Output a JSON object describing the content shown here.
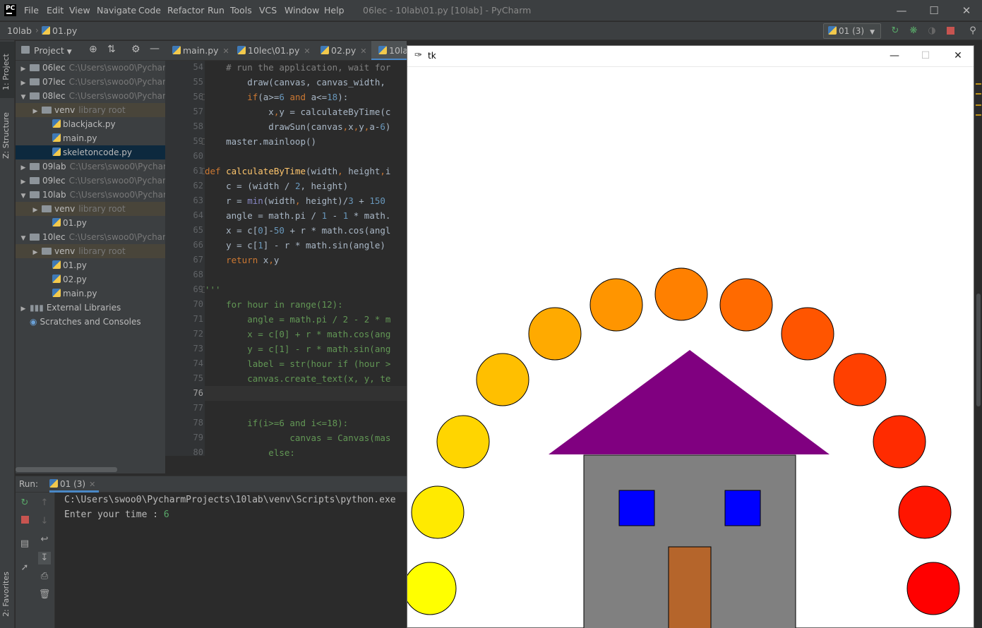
{
  "colors": {
    "accent": "#4a88c7",
    "ide_bg": "#2b2b2b",
    "panel_bg": "#3c3f41",
    "selection": "#0d293e",
    "tk_roof": "#800080",
    "tk_wall": "#808080",
    "tk_window": "#0000ff",
    "tk_door": "#b5652b"
  },
  "titlebar": {
    "menu": [
      "File",
      "Edit",
      "View",
      "Navigate",
      "Code",
      "Refactor",
      "Run",
      "Tools",
      "VCS",
      "Window",
      "Help"
    ],
    "window_title": "06lec - 10lab\\01.py [10lab] - PyCharm",
    "logo": "PC"
  },
  "navbar": {
    "crumb_project": "10lab",
    "crumb_file": "01.py",
    "run_config": "01 (3)"
  },
  "left_strip": {
    "project_tab": "1: Project",
    "structure_tab": "Z: Structure",
    "favorites_tab": "2: Favorites"
  },
  "project_panel": {
    "header": "Project",
    "tree": [
      {
        "name": "06lec",
        "path": "C:\\Users\\swoo0\\Pycharm",
        "arrow": "▶",
        "kind": "folder",
        "indent": 0
      },
      {
        "name": "07lec",
        "path": "C:\\Users\\swoo0\\Pycharm",
        "arrow": "▶",
        "kind": "folder",
        "indent": 0
      },
      {
        "name": "08lec",
        "path": "C:\\Users\\swoo0\\Pycharm",
        "arrow": "▼",
        "kind": "folder",
        "indent": 0
      },
      {
        "name": "venv",
        "hint": "library root",
        "arrow": "▶",
        "kind": "lib",
        "indent": 1
      },
      {
        "name": "blackjack.py",
        "kind": "py",
        "indent": 2
      },
      {
        "name": "main.py",
        "kind": "py",
        "indent": 2
      },
      {
        "name": "skeletoncode.py",
        "kind": "py",
        "indent": 2,
        "selected": true
      },
      {
        "name": "09lab",
        "path": "C:\\Users\\swoo0\\Pychar",
        "arrow": "▶",
        "kind": "folder",
        "indent": 0
      },
      {
        "name": "09lec",
        "path": "C:\\Users\\swoo0\\Pycharm",
        "arrow": "▶",
        "kind": "folder",
        "indent": 0
      },
      {
        "name": "10lab",
        "path": "C:\\Users\\swoo0\\Pychar",
        "arrow": "▼",
        "kind": "folder",
        "indent": 0
      },
      {
        "name": "venv",
        "hint": "library root",
        "arrow": "▶",
        "kind": "lib",
        "indent": 1
      },
      {
        "name": "01.py",
        "kind": "py",
        "indent": 2
      },
      {
        "name": "10lec",
        "path": "C:\\Users\\swoo0\\Pycharm",
        "arrow": "▼",
        "kind": "folder",
        "indent": 0
      },
      {
        "name": "venv",
        "hint": "library root",
        "arrow": "▶",
        "kind": "lib",
        "indent": 1
      },
      {
        "name": "01.py",
        "kind": "py",
        "indent": 2
      },
      {
        "name": "02.py",
        "kind": "py",
        "indent": 2
      },
      {
        "name": "main.py",
        "kind": "py",
        "indent": 2
      },
      {
        "name": "External Libraries",
        "arrow": "▶",
        "kind": "extlib",
        "indent": 0
      },
      {
        "name": "Scratches and Consoles",
        "kind": "scratch",
        "indent": 0
      }
    ]
  },
  "editor": {
    "tabs": [
      {
        "label": "main.py"
      },
      {
        "label": "10lec\\01.py"
      },
      {
        "label": "02.py"
      },
      {
        "label": "10la"
      }
    ],
    "line_numbers": [
      "54",
      "55",
      "56",
      "57",
      "58",
      "59",
      "60",
      "61",
      "62",
      "63",
      "64",
      "65",
      "66",
      "67",
      "68",
      "69",
      "70",
      "71",
      "72",
      "73",
      "74",
      "75",
      "76",
      "77",
      "78",
      "79",
      "80"
    ],
    "current_line": "76",
    "lines": [
      [
        {
          "t": "    # run the application, wait for",
          "c": "#808080"
        }
      ],
      [
        {
          "t": "        draw(canvas, canvas_width,",
          "c": "#a9b7c6"
        }
      ],
      [
        {
          "t": "        ",
          "c": "#a9b7c6"
        },
        {
          "t": "if",
          "c": "#cc7832"
        },
        {
          "t": "(a>=",
          "c": "#a9b7c6"
        },
        {
          "t": "6",
          "c": "#6897bb"
        },
        {
          "t": " and ",
          "c": "#cc7832"
        },
        {
          "t": "a<=",
          "c": "#a9b7c6"
        },
        {
          "t": "18",
          "c": "#6897bb"
        },
        {
          "t": "):",
          "c": "#a9b7c6"
        }
      ],
      [
        {
          "t": "            x",
          "c": "#a9b7c6"
        },
        {
          "t": ",",
          "c": "#cc7832"
        },
        {
          "t": "y = calculateByTime(c",
          "c": "#a9b7c6"
        }
      ],
      [
        {
          "t": "            drawSun(canvas",
          "c": "#a9b7c6"
        },
        {
          "t": ",",
          "c": "#cc7832"
        },
        {
          "t": "x",
          "c": "#a9b7c6"
        },
        {
          "t": ",",
          "c": "#cc7832"
        },
        {
          "t": "y",
          "c": "#a9b7c6"
        },
        {
          "t": ",",
          "c": "#cc7832"
        },
        {
          "t": "a-",
          "c": "#a9b7c6"
        },
        {
          "t": "6",
          "c": "#6897bb"
        },
        {
          "t": ")",
          "c": "#a9b7c6"
        }
      ],
      [
        {
          "t": "    master.mainloop()",
          "c": "#a9b7c6"
        }
      ],
      [
        {
          "t": "",
          "c": "#a9b7c6"
        }
      ],
      [
        {
          "t": "def ",
          "c": "#cc7832"
        },
        {
          "t": "calculateByTime",
          "c": "#ffc66d"
        },
        {
          "t": "(width",
          "c": "#a9b7c6"
        },
        {
          "t": ", ",
          "c": "#cc7832"
        },
        {
          "t": "height",
          "c": "#a9b7c6"
        },
        {
          "t": ",",
          "c": "#cc7832"
        },
        {
          "t": "i",
          "c": "#a9b7c6"
        }
      ],
      [
        {
          "t": "    c = (width / ",
          "c": "#a9b7c6"
        },
        {
          "t": "2",
          "c": "#6897bb"
        },
        {
          "t": ", height)",
          "c": "#a9b7c6"
        }
      ],
      [
        {
          "t": "    r = ",
          "c": "#a9b7c6"
        },
        {
          "t": "min",
          "c": "#8888c6"
        },
        {
          "t": "(width",
          "c": "#a9b7c6"
        },
        {
          "t": ", ",
          "c": "#cc7832"
        },
        {
          "t": "height)/",
          "c": "#a9b7c6"
        },
        {
          "t": "3",
          "c": "#6897bb"
        },
        {
          "t": " + ",
          "c": "#a9b7c6"
        },
        {
          "t": "150",
          "c": "#6897bb"
        }
      ],
      [
        {
          "t": "    angle = math.pi / ",
          "c": "#a9b7c6"
        },
        {
          "t": "1",
          "c": "#6897bb"
        },
        {
          "t": " - ",
          "c": "#a9b7c6"
        },
        {
          "t": "1",
          "c": "#6897bb"
        },
        {
          "t": " * math.",
          "c": "#a9b7c6"
        }
      ],
      [
        {
          "t": "    x = c[",
          "c": "#a9b7c6"
        },
        {
          "t": "0",
          "c": "#6897bb"
        },
        {
          "t": "]-",
          "c": "#a9b7c6"
        },
        {
          "t": "50",
          "c": "#6897bb"
        },
        {
          "t": " + r * math.cos(angl",
          "c": "#a9b7c6"
        }
      ],
      [
        {
          "t": "    y = c[",
          "c": "#a9b7c6"
        },
        {
          "t": "1",
          "c": "#6897bb"
        },
        {
          "t": "] - r * math.sin(angle)",
          "c": "#a9b7c6"
        }
      ],
      [
        {
          "t": "    ",
          "c": "#a9b7c6"
        },
        {
          "t": "return ",
          "c": "#cc7832"
        },
        {
          "t": "x",
          "c": "#a9b7c6"
        },
        {
          "t": ",",
          "c": "#cc7832"
        },
        {
          "t": "y",
          "c": "#a9b7c6"
        }
      ],
      [
        {
          "t": "",
          "c": "#a9b7c6"
        }
      ],
      [
        {
          "t": "'''",
          "c": "#629755"
        }
      ],
      [
        {
          "t": "    for hour in range(12):",
          "c": "#629755"
        }
      ],
      [
        {
          "t": "        angle = math.pi / 2 - 2 * m",
          "c": "#629755"
        }
      ],
      [
        {
          "t": "        x = c[0] + r * math.cos(ang",
          "c": "#629755"
        }
      ],
      [
        {
          "t": "        y = c[1] - r * math.sin(ang",
          "c": "#629755"
        }
      ],
      [
        {
          "t": "        label = str(hour if (hour >",
          "c": "#629755"
        }
      ],
      [
        {
          "t": "        canvas.create_text(x, y, te",
          "c": "#629755"
        }
      ],
      [
        {
          "t": "",
          "c": "#629755"
        }
      ],
      [
        {
          "t": "",
          "c": "#629755"
        }
      ],
      [
        {
          "t": "        if(i>=6 and i<=18):",
          "c": "#629755"
        }
      ],
      [
        {
          "t": "                canvas = Canvas(mas",
          "c": "#629755"
        }
      ],
      [
        {
          "t": "            else:",
          "c": "#629755"
        }
      ]
    ]
  },
  "run_panel": {
    "label": "Run:",
    "tab": "01 (3)",
    "console_line1": "C:\\Users\\swoo0\\PycharmProjects\\10lab\\venv\\Scripts\\python.exe",
    "console_line2": "Enter your time : ",
    "console_input": "6"
  },
  "tk_window": {
    "title": "tk",
    "suns": [
      {
        "color": "#ffff00"
      },
      {
        "color": "#ffea00"
      },
      {
        "color": "#ffd500"
      },
      {
        "color": "#ffbf00"
      },
      {
        "color": "#ffaa00"
      },
      {
        "color": "#ff9500"
      },
      {
        "color": "#ff8000"
      },
      {
        "color": "#ff6a00"
      },
      {
        "color": "#ff5500"
      },
      {
        "color": "#ff4000"
      },
      {
        "color": "#ff2b00"
      },
      {
        "color": "#ff1500"
      },
      {
        "color": "#ff0000"
      }
    ]
  }
}
